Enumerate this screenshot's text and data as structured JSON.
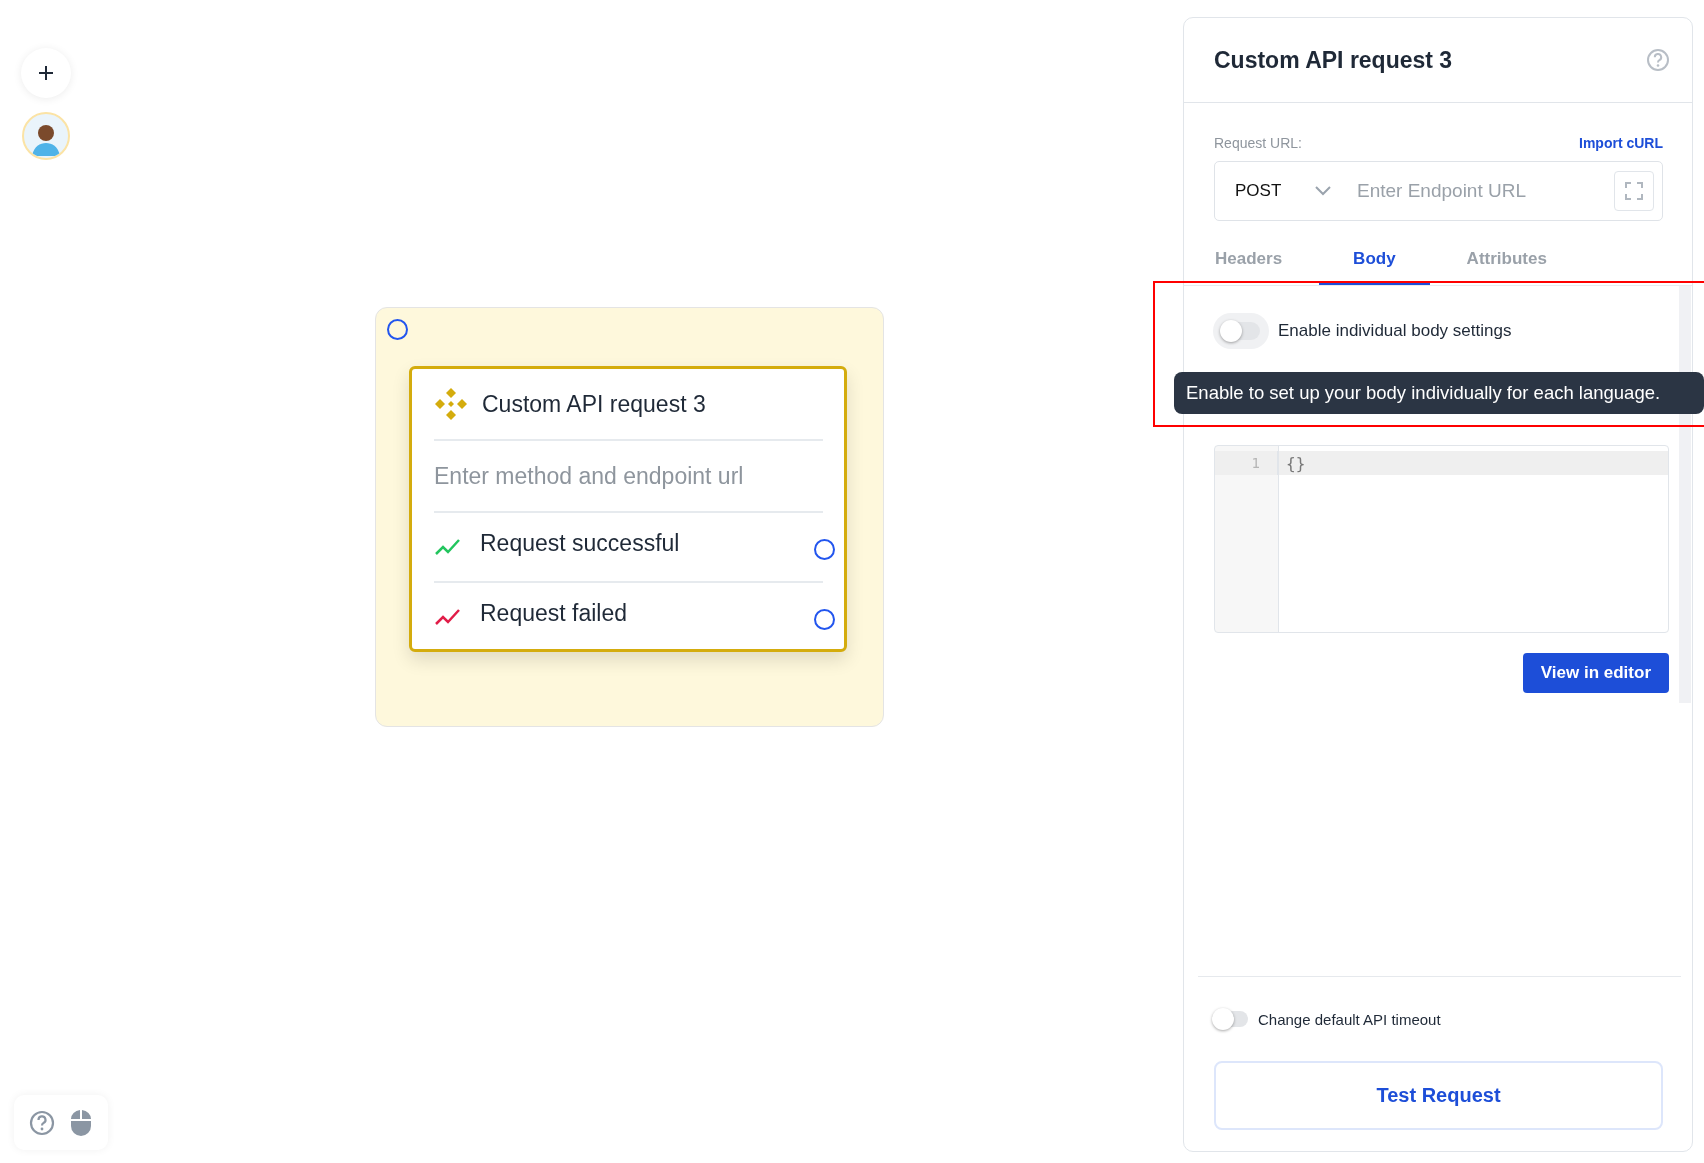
{
  "canvas": {
    "node": {
      "title": "Custom API request 3",
      "placeholder": "Enter method and endpoint url",
      "outputs": [
        {
          "label": "Request successful",
          "kind": "success"
        },
        {
          "label": "Request failed",
          "kind": "failure"
        }
      ]
    }
  },
  "panel": {
    "title": "Custom API request 3",
    "request_url_label": "Request URL:",
    "import_link": "Import cURL",
    "method": "POST",
    "url_placeholder": "Enter Endpoint URL",
    "tabs": [
      {
        "label": "Headers",
        "selected": false
      },
      {
        "label": "Body",
        "selected": true
      },
      {
        "label": "Attributes",
        "selected": false
      }
    ],
    "body_toggle": {
      "label": "Enable individual body settings",
      "on": false
    },
    "tooltip": "Enable to set up your body individually for each language.",
    "editor": {
      "lines": [
        {
          "number": "1",
          "code": "{}"
        }
      ]
    },
    "view_button": "View in editor",
    "timeout_toggle": {
      "label": "Change default API timeout",
      "on": false
    },
    "test_button": "Test Request"
  }
}
